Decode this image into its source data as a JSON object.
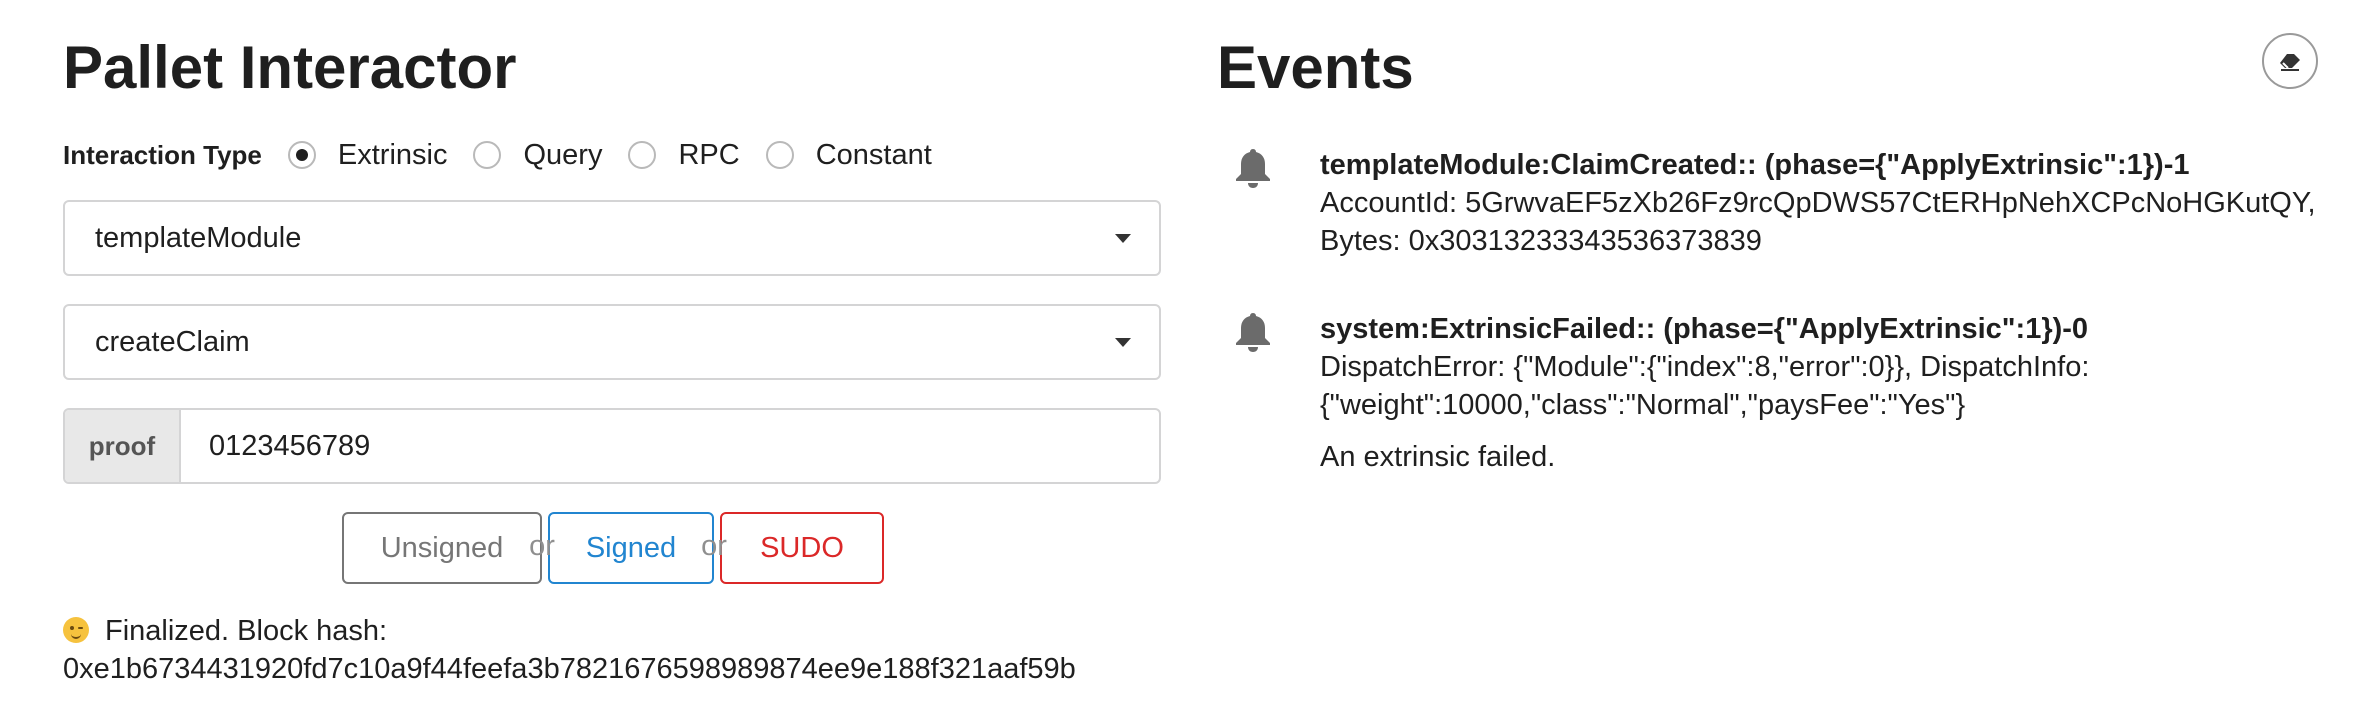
{
  "left": {
    "title": "Pallet Interactor",
    "interaction_type": {
      "label": "Interaction Type",
      "options": [
        "Extrinsic",
        "Query",
        "RPC",
        "Constant"
      ],
      "selected": "Extrinsic"
    },
    "pallet_dropdown": {
      "value": "templateModule"
    },
    "callable_dropdown": {
      "value": "createClaim"
    },
    "param": {
      "label": "proof",
      "value": "0123456789"
    },
    "buttons": {
      "unsigned": "Unsigned",
      "or": "or",
      "signed": "Signed",
      "sudo": "SUDO"
    },
    "status": {
      "emoji": "😉",
      "text": "Finalized. Block hash:",
      "hash": "0xe1b6734431920fd7c10a9f44feefa3b7821676598989874ee9e188f321aaf59b"
    }
  },
  "right": {
    "title": "Events",
    "clear_icon": "eraser-icon",
    "events": [
      {
        "icon": "bell-icon",
        "title": "templateModule:ClaimCreated:: (phase={\"ApplyExtrinsic\":1})-1",
        "detail": "AccountId: 5GrwvaEF5zXb26Fz9rcQpDWS57CtERHpNehXCPcNoHGKutQY, Bytes: 0x30313233343536373839",
        "doc": ""
      },
      {
        "icon": "bell-icon",
        "title": "system:ExtrinsicFailed:: (phase={\"ApplyExtrinsic\":1})-0",
        "detail": "DispatchError: {\"Module\":{\"index\":8,\"error\":0}}, DispatchInfo: {\"weight\":10000,\"class\":\"Normal\",\"paysFee\":\"Yes\"}",
        "doc": "An extrinsic failed."
      }
    ]
  },
  "colors": {
    "signed": "#2185d0",
    "sudo": "#db2828",
    "unsigned": "#767676"
  }
}
